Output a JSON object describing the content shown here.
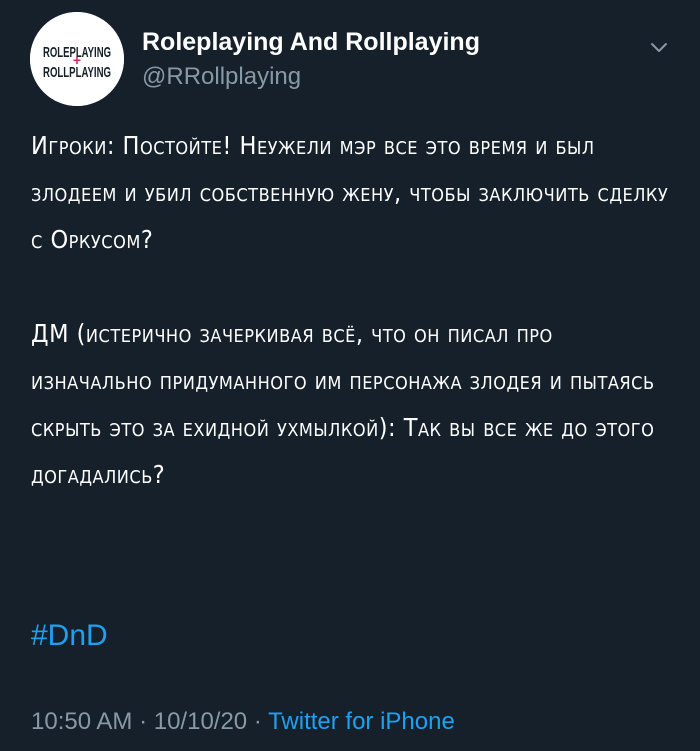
{
  "author": {
    "avatar_text_top": "ROLEPLAYING",
    "avatar_text_mid": "+",
    "avatar_text_bottom": "ROLLPLAYING",
    "display_name": "Roleplaying And Rollplaying",
    "handle": "@RRollplaying",
    "menu_icon": "chevron-down-icon"
  },
  "tweet": {
    "paragraph1": "Игроки: Постойте! Неужели мэр все это время и был злодеем и убил собственную жену, чтобы заключить сделку с Оркусом?",
    "paragraph2": "ДМ (истерично зачеркивая всё, что он писал про изначально придуманного им персонажа злодея и пытаясь скрыть это за ехидной ухмылкой): Так вы все же до этого догадались?",
    "hashtag": "#DnD"
  },
  "meta": {
    "time": "10:50 AM",
    "sep1": " · ",
    "date": "10/10/20",
    "sep2": " · ",
    "source": "Twitter for iPhone"
  },
  "colors": {
    "background": "#15202b",
    "accent": "#1da1f2",
    "muted": "#8899a6"
  }
}
